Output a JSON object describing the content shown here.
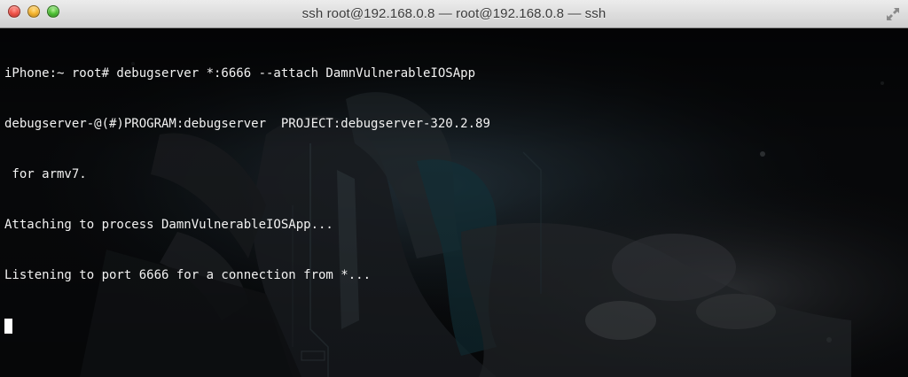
{
  "window": {
    "title": "ssh root@192.168.0.8 — root@192.168.0.8 — ssh",
    "controls": [
      "close",
      "minimize",
      "zoom"
    ],
    "fullscreen_icon": "fullscreen-arrows-icon"
  },
  "terminal": {
    "lines": [
      "iPhone:~ root# debugserver *:6666 --attach DamnVulnerableIOSApp",
      "debugserver-@(#)PROGRAM:debugserver  PROJECT:debugserver-320.2.89",
      " for armv7.",
      "Attaching to process DamnVulnerableIOSApp...",
      "Listening to port 6666 for a connection from *..."
    ],
    "text_color": "#f2f2f2",
    "cursor_color": "#ffffff"
  }
}
